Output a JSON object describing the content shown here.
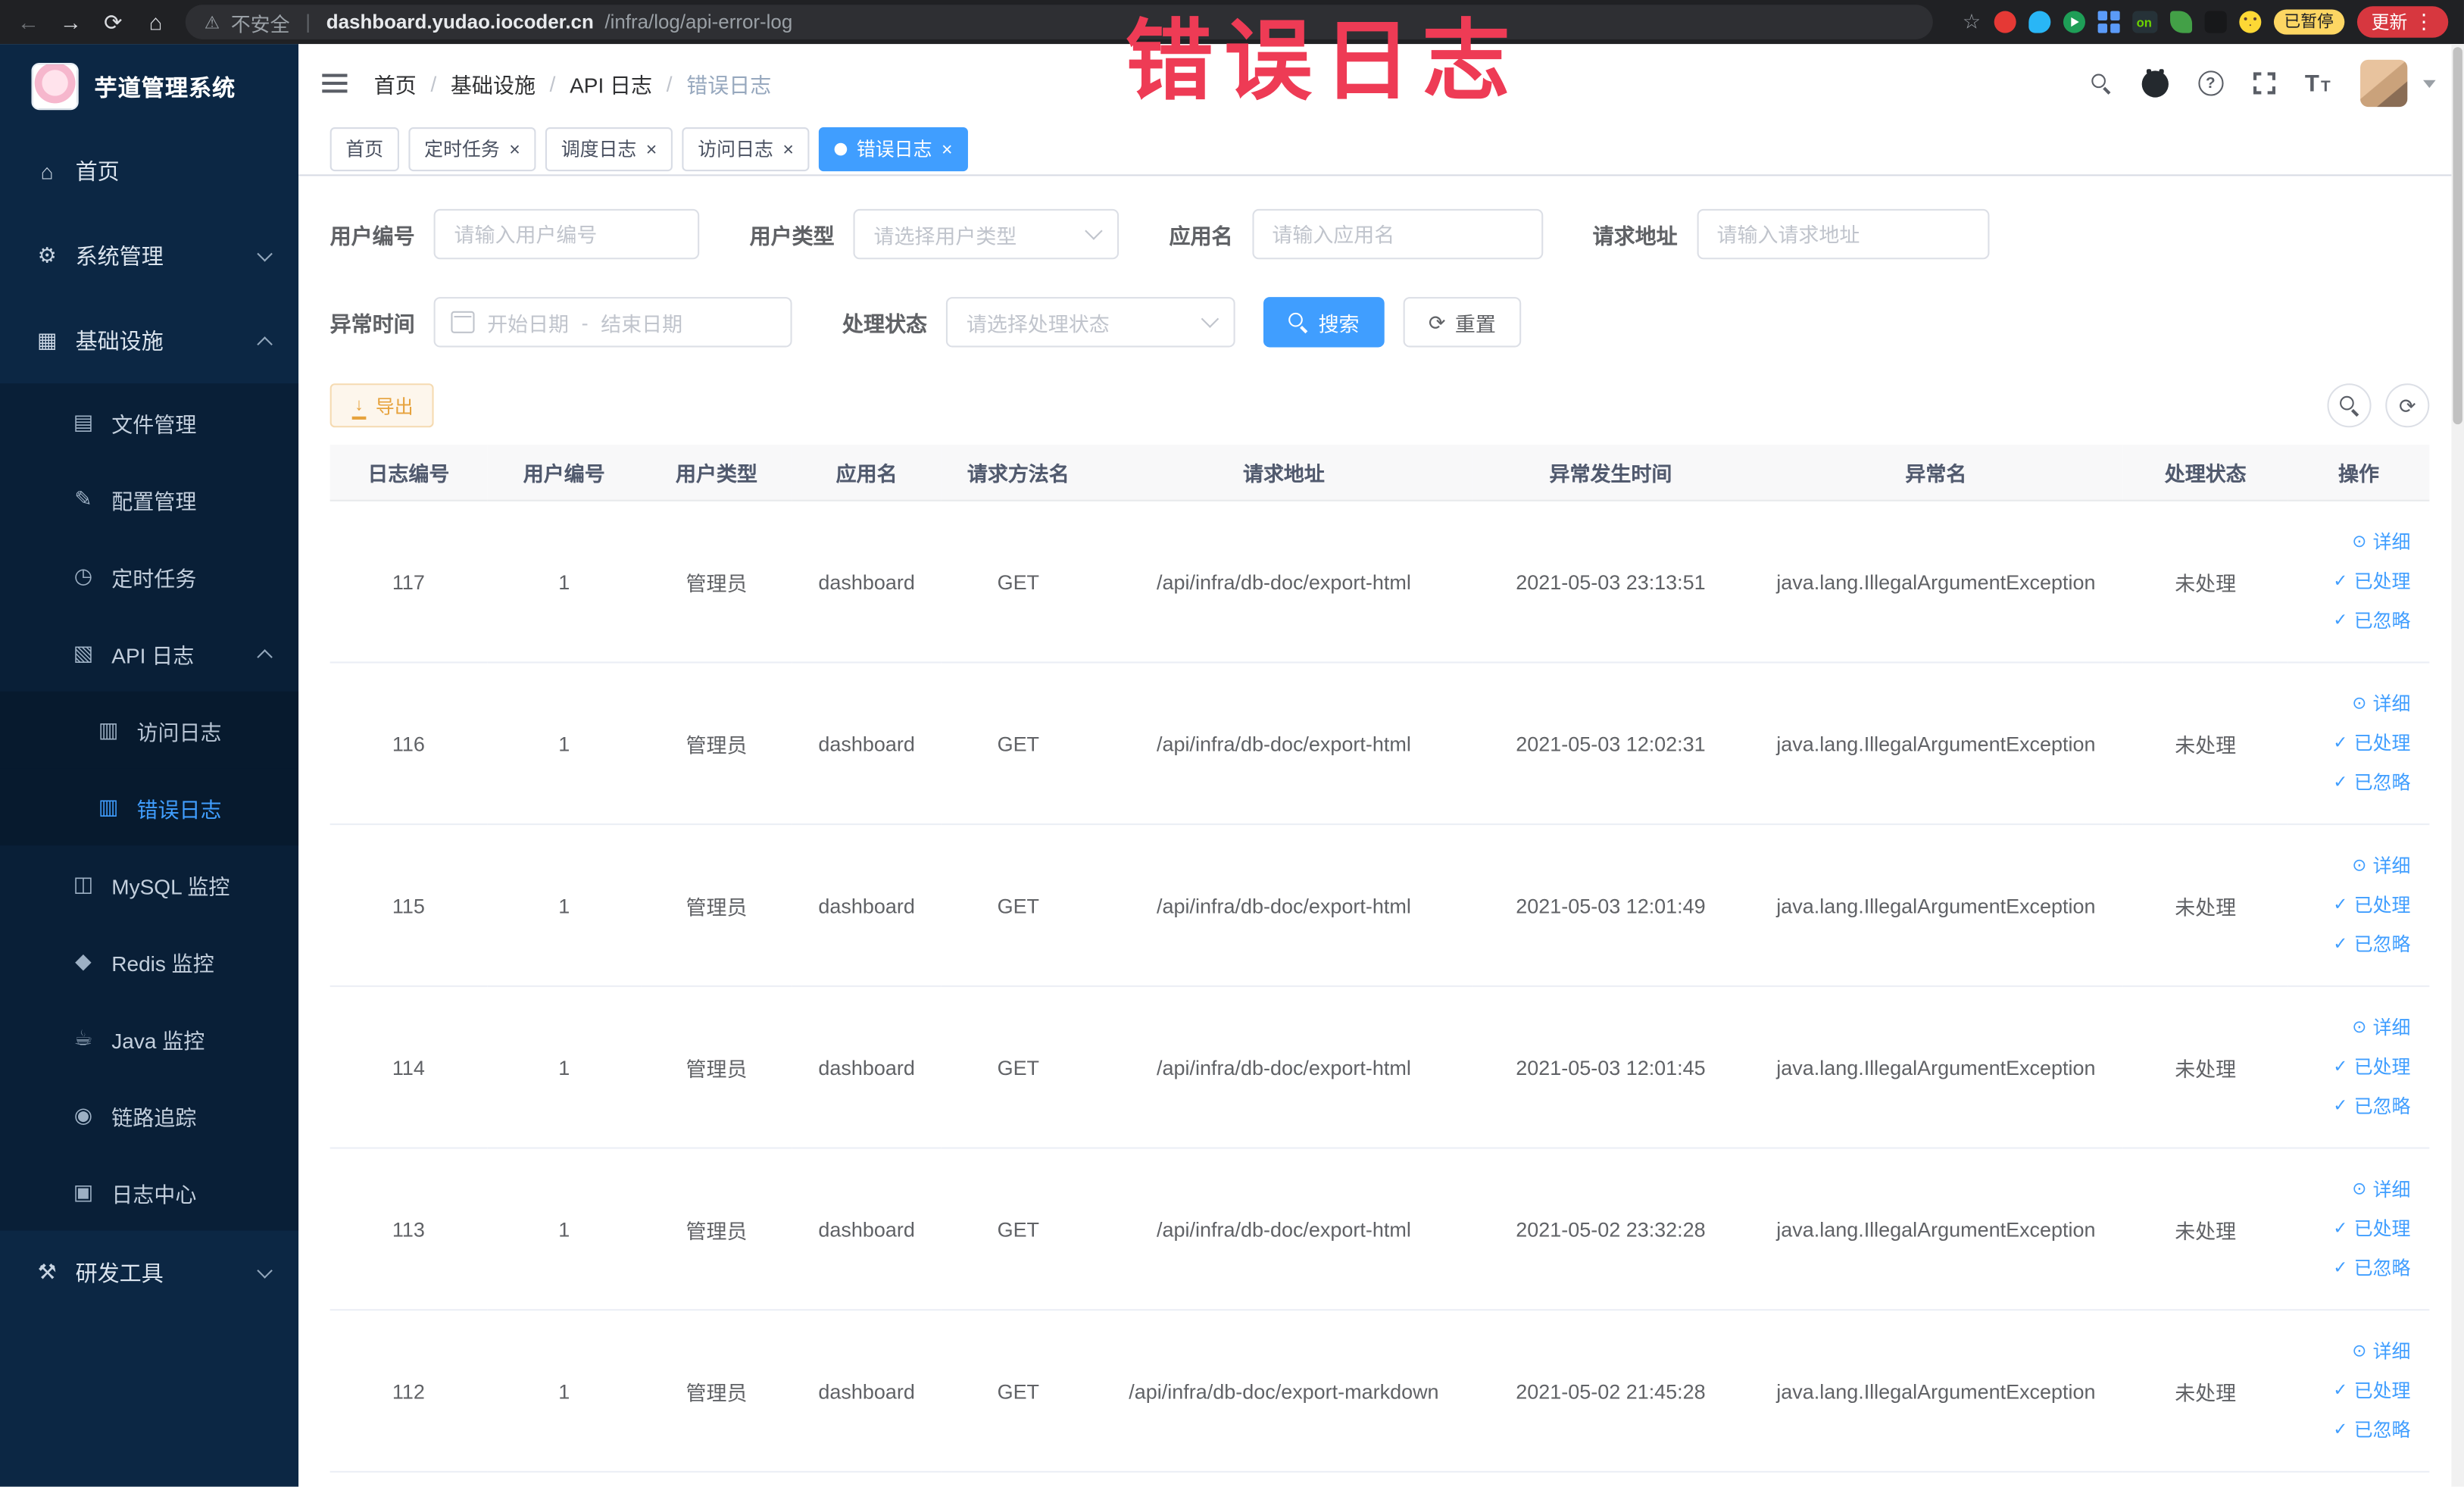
{
  "browser": {
    "security_label": "不安全",
    "url_host": "dashboard.yudao.iocoder.cn",
    "url_path": "/infra/log/api-error-log",
    "ext_on_label": "on",
    "paused_badge": "已暂停",
    "update_label": "更新"
  },
  "watermark": "错误日志",
  "icons": {
    "back": "←",
    "forward": "→",
    "reload": "⟳",
    "chrome_home": "⌂",
    "warning": "⚠",
    "star": "☆",
    "overflow": "⋮",
    "close": "×",
    "help": "?",
    "font_large": "T",
    "font_small": "T",
    "home": "⌂",
    "system": "⚙",
    "infra": "▦",
    "file": "▤",
    "config": "✎",
    "job": "◷",
    "api_log": "▧",
    "access_log": "▥",
    "error_log": "▥",
    "mysql": "◫",
    "redis": "◆",
    "java": "☕",
    "trace": "◉",
    "log_center": "▣",
    "devtools": "⚒",
    "view": "⊙",
    "check": "✓",
    "refresh": "⟳",
    "download": "↓"
  },
  "sidebar": {
    "title": "芋道管理系统",
    "items": [
      {
        "label": "首页"
      },
      {
        "label": "系统管理"
      },
      {
        "label": "基础设施"
      },
      {
        "label": "文件管理"
      },
      {
        "label": "配置管理"
      },
      {
        "label": "定时任务"
      },
      {
        "label": "API 日志"
      },
      {
        "label": "访问日志"
      },
      {
        "label": "错误日志"
      },
      {
        "label": "MySQL 监控"
      },
      {
        "label": "Redis 监控"
      },
      {
        "label": "Java 监控"
      },
      {
        "label": "链路追踪"
      },
      {
        "label": "日志中心"
      },
      {
        "label": "研发工具"
      }
    ]
  },
  "breadcrumb": {
    "separator": "/",
    "items": [
      "首页",
      "基础设施",
      "API 日志",
      "错误日志"
    ]
  },
  "tabs": [
    {
      "label": "首页"
    },
    {
      "label": "定时任务"
    },
    {
      "label": "调度日志"
    },
    {
      "label": "访问日志"
    },
    {
      "label": "错误日志"
    }
  ],
  "filters": {
    "user_id": {
      "label": "用户编号",
      "placeholder": "请输入用户编号"
    },
    "user_type": {
      "label": "用户类型",
      "placeholder": "请选择用户类型"
    },
    "app_name": {
      "label": "应用名",
      "placeholder": "请输入应用名"
    },
    "request_url": {
      "label": "请求地址",
      "placeholder": "请输入请求地址"
    },
    "exception_time": {
      "label": "异常时间",
      "start_placeholder": "开始日期",
      "range_separator": "-",
      "end_placeholder": "结束日期"
    },
    "process_status": {
      "label": "处理状态",
      "placeholder": "请选择处理状态"
    },
    "search_label": "搜索",
    "reset_label": "重置"
  },
  "toolbar": {
    "export_label": "导出"
  },
  "table": {
    "columns": [
      "日志编号",
      "用户编号",
      "用户类型",
      "应用名",
      "请求方法名",
      "请求地址",
      "异常发生时间",
      "异常名",
      "处理状态",
      "操作"
    ],
    "actions": {
      "detail": "详细",
      "processed": "已处理",
      "ignored": "已忽略"
    },
    "rows": [
      {
        "id": "117",
        "user_id": "1",
        "user_type": "管理员",
        "app": "dashboard",
        "method": "GET",
        "url": "/api/infra/db-doc/export-html",
        "time": "2021-05-03 23:13:51",
        "exception": "java.lang.IllegalArgumentException",
        "status": "未处理"
      },
      {
        "id": "116",
        "user_id": "1",
        "user_type": "管理员",
        "app": "dashboard",
        "method": "GET",
        "url": "/api/infra/db-doc/export-html",
        "time": "2021-05-03 12:02:31",
        "exception": "java.lang.IllegalArgumentException",
        "status": "未处理"
      },
      {
        "id": "115",
        "user_id": "1",
        "user_type": "管理员",
        "app": "dashboard",
        "method": "GET",
        "url": "/api/infra/db-doc/export-html",
        "time": "2021-05-03 12:01:49",
        "exception": "java.lang.IllegalArgumentException",
        "status": "未处理"
      },
      {
        "id": "114",
        "user_id": "1",
        "user_type": "管理员",
        "app": "dashboard",
        "method": "GET",
        "url": "/api/infra/db-doc/export-html",
        "time": "2021-05-03 12:01:45",
        "exception": "java.lang.IllegalArgumentException",
        "status": "未处理"
      },
      {
        "id": "113",
        "user_id": "1",
        "user_type": "管理员",
        "app": "dashboard",
        "method": "GET",
        "url": "/api/infra/db-doc/export-html",
        "time": "2021-05-02 23:32:28",
        "exception": "java.lang.IllegalArgumentException",
        "status": "未处理"
      },
      {
        "id": "112",
        "user_id": "1",
        "user_type": "管理员",
        "app": "dashboard",
        "method": "GET",
        "url": "/api/infra/db-doc/export-markdown",
        "time": "2021-05-02 21:45:28",
        "exception": "java.lang.IllegalArgumentException",
        "status": "未处理"
      }
    ]
  }
}
